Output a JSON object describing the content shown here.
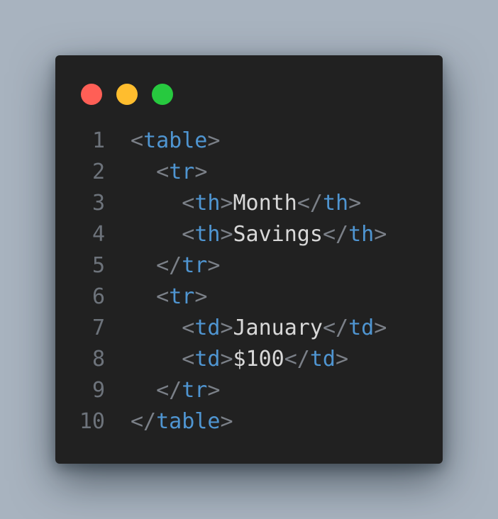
{
  "window": {
    "traffic_lights": [
      {
        "name": "close",
        "color": "#ff5f56"
      },
      {
        "name": "minimize",
        "color": "#ffbd2e"
      },
      {
        "name": "maximize",
        "color": "#27c93f"
      }
    ]
  },
  "code": {
    "language": "html",
    "lines": [
      {
        "number": "1",
        "indent": "",
        "tokens": [
          [
            "p",
            "<"
          ],
          [
            "t",
            "table"
          ],
          [
            "p",
            ">"
          ]
        ]
      },
      {
        "number": "2",
        "indent": "  ",
        "tokens": [
          [
            "p",
            "<"
          ],
          [
            "t",
            "tr"
          ],
          [
            "p",
            ">"
          ]
        ]
      },
      {
        "number": "3",
        "indent": "    ",
        "tokens": [
          [
            "p",
            "<"
          ],
          [
            "t",
            "th"
          ],
          [
            "p",
            ">"
          ],
          [
            "x",
            "Month"
          ],
          [
            "p",
            "</"
          ],
          [
            "t",
            "th"
          ],
          [
            "p",
            ">"
          ]
        ]
      },
      {
        "number": "4",
        "indent": "    ",
        "tokens": [
          [
            "p",
            "<"
          ],
          [
            "t",
            "th"
          ],
          [
            "p",
            ">"
          ],
          [
            "x",
            "Savings"
          ],
          [
            "p",
            "</"
          ],
          [
            "t",
            "th"
          ],
          [
            "p",
            ">"
          ]
        ]
      },
      {
        "number": "5",
        "indent": "  ",
        "tokens": [
          [
            "p",
            "</"
          ],
          [
            "t",
            "tr"
          ],
          [
            "p",
            ">"
          ]
        ]
      },
      {
        "number": "6",
        "indent": "  ",
        "tokens": [
          [
            "p",
            "<"
          ],
          [
            "t",
            "tr"
          ],
          [
            "p",
            ">"
          ]
        ]
      },
      {
        "number": "7",
        "indent": "    ",
        "tokens": [
          [
            "p",
            "<"
          ],
          [
            "t",
            "td"
          ],
          [
            "p",
            ">"
          ],
          [
            "x",
            "January"
          ],
          [
            "p",
            "</"
          ],
          [
            "t",
            "td"
          ],
          [
            "p",
            ">"
          ]
        ]
      },
      {
        "number": "8",
        "indent": "    ",
        "tokens": [
          [
            "p",
            "<"
          ],
          [
            "t",
            "td"
          ],
          [
            "p",
            ">"
          ],
          [
            "x",
            "$100"
          ],
          [
            "p",
            "</"
          ],
          [
            "t",
            "td"
          ],
          [
            "p",
            ">"
          ]
        ]
      },
      {
        "number": "9",
        "indent": "  ",
        "tokens": [
          [
            "p",
            "</"
          ],
          [
            "t",
            "tr"
          ],
          [
            "p",
            ">"
          ]
        ]
      },
      {
        "number": "10",
        "indent": "",
        "tokens": [
          [
            "p",
            "</"
          ],
          [
            "t",
            "table"
          ],
          [
            "p",
            ">"
          ]
        ]
      }
    ]
  }
}
